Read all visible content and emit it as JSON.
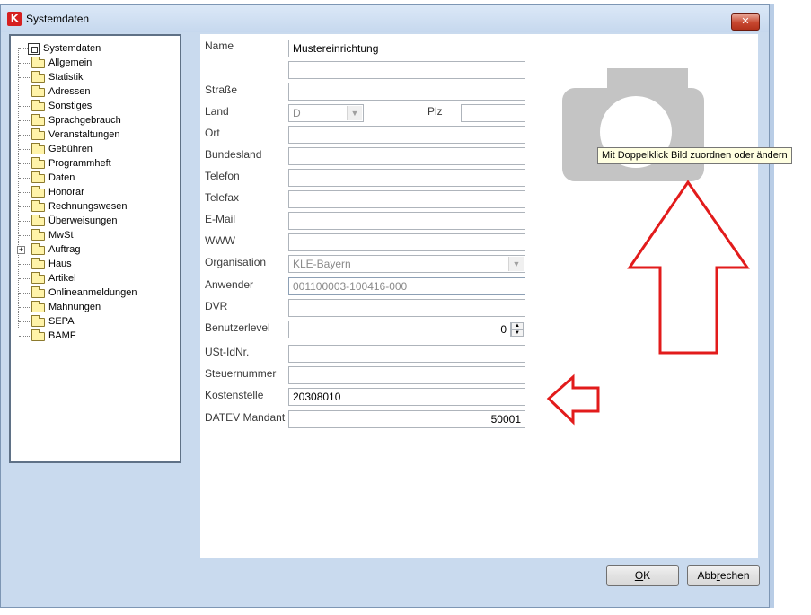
{
  "window": {
    "title": "Systemdaten",
    "icon": "K",
    "close": "✕"
  },
  "tree": {
    "root": "Systemdaten",
    "items": [
      "Allgemein",
      "Statistik",
      "Adressen",
      "Sonstiges",
      "Sprachgebrauch",
      "Veranstaltungen",
      "Gebühren",
      "Programmheft",
      "Daten",
      "Honorar",
      "Rechnungswesen",
      "Überweisungen",
      "MwSt",
      "Auftrag",
      "Haus",
      "Artikel",
      "Onlineanmeldungen",
      "Mahnungen",
      "SEPA",
      "BAMF"
    ],
    "expandable": "Auftrag",
    "expand_glyph": "+"
  },
  "form": {
    "labels": {
      "name": "Name",
      "strasse": "Straße",
      "land": "Land",
      "plz": "Plz",
      "ort": "Ort",
      "bundesland": "Bundesland",
      "telefon": "Telefon",
      "telefax": "Telefax",
      "email": "E-Mail",
      "www": "WWW",
      "organisation": "Organisation",
      "anwender": "Anwender",
      "dvr": "DVR",
      "benutzerlevel": "Benutzerlevel",
      "ust": "USt-IdNr.",
      "steuernummer": "Steuernummer",
      "kostenstelle": "Kostenstelle",
      "datev": "DATEV Mandant"
    },
    "values": {
      "name": "Mustereinrichtung",
      "name2": "",
      "strasse": "",
      "land": "D",
      "plz": "",
      "ort": "",
      "bundesland": "",
      "telefon": "",
      "telefax": "",
      "email": "",
      "www": "",
      "organisation": "KLE-Bayern",
      "anwender": "001100003-100416-000",
      "dvr": "",
      "benutzerlevel": "0",
      "ust": "",
      "steuernummer": "",
      "kostenstelle": "20308010",
      "datev": "50001"
    },
    "tooltip": "Mit Doppelklick Bild zuordnen oder ändern"
  },
  "buttons": {
    "ok_underline": "O",
    "ok_rest": "K",
    "cancel_pre": "Abb",
    "cancel_underline": "r",
    "cancel_post": "echen"
  },
  "colors": {
    "annotation_arrow": "#e21b1b",
    "window_bg": "#c9daee",
    "placeholder_grey": "#c4c4c4"
  },
  "icons": {
    "camera": "camera-placeholder-icon",
    "dropdown": "chevron-down-icon",
    "folder": "folder-icon"
  }
}
